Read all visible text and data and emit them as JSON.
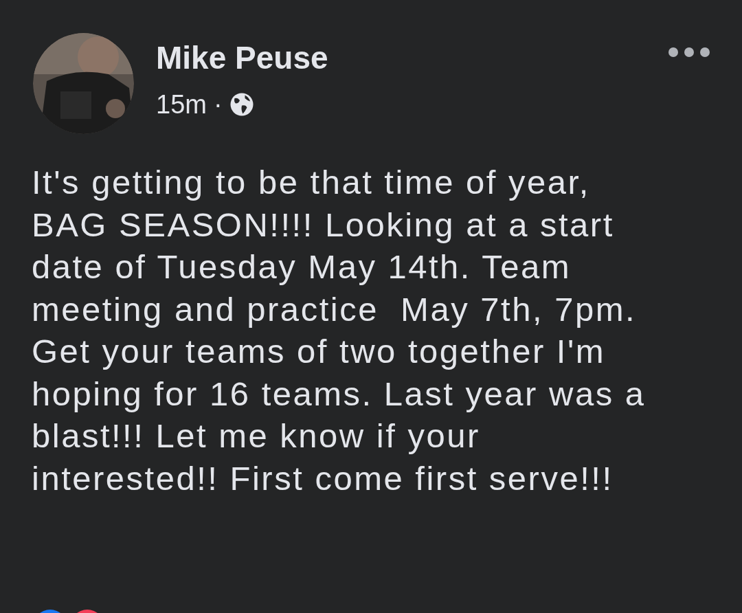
{
  "post": {
    "author": "Mike Peuse",
    "time": "15m",
    "separator": "·",
    "body_lines": [
      "It's getting to be that time of year,",
      "BAG SEASON!!!! Looking at a start",
      "date of Tuesday May 14th. Team",
      "meeting and practice  May 7th, 7pm.",
      "Get your teams of two together I'm",
      "hoping for 16 teams. Last year was a",
      "blast!!! Let me know if your",
      "interested!! First come first serve!!!"
    ]
  }
}
